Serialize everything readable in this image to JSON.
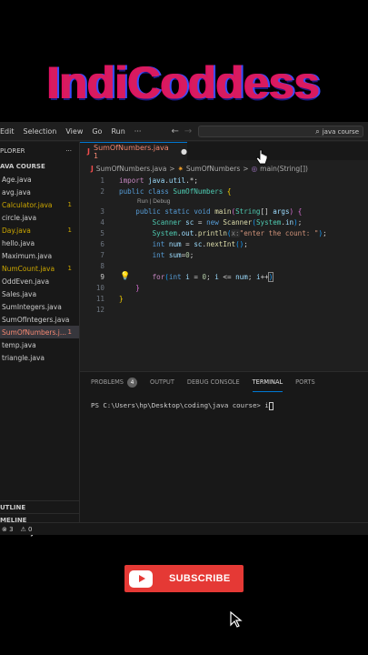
{
  "brand": {
    "title": "IndiCoddess"
  },
  "titlebar": {
    "menu": [
      "Edit",
      "Selection",
      "View",
      "Go",
      "Run",
      "···"
    ],
    "back": "←",
    "forward": "→",
    "search_text": "java course"
  },
  "sidebar": {
    "explorer_label": "PLORER",
    "more": "···",
    "folder_label": "AVA COURSE",
    "files": [
      {
        "name": "Age.java",
        "badge": "",
        "state": "normal"
      },
      {
        "name": "avg.java",
        "badge": "",
        "state": "normal"
      },
      {
        "name": "Calculator.java",
        "badge": "1",
        "state": "warn"
      },
      {
        "name": "circle.java",
        "badge": "",
        "state": "normal"
      },
      {
        "name": "Day.java",
        "badge": "1",
        "state": "warn"
      },
      {
        "name": "hello.java",
        "badge": "",
        "state": "normal"
      },
      {
        "name": "Maximum.java",
        "badge": "",
        "state": "normal"
      },
      {
        "name": "NumCount.java",
        "badge": "1",
        "state": "warn"
      },
      {
        "name": "OddEven.java",
        "badge": "",
        "state": "normal"
      },
      {
        "name": "Sales.java",
        "badge": "",
        "state": "normal"
      },
      {
        "name": "SumIntegers.java",
        "badge": "",
        "state": "normal"
      },
      {
        "name": "SumOfIntegers.java",
        "badge": "",
        "state": "normal"
      },
      {
        "name": "SumOfNumbers.j...",
        "badge": "1",
        "state": "err"
      },
      {
        "name": "temp.java",
        "badge": "",
        "state": "normal"
      },
      {
        "name": "triangle.java",
        "badge": "",
        "state": "normal"
      }
    ],
    "outline": "UTLINE",
    "timeline": "MELINE",
    "java_projects": "AVA PROJECTS"
  },
  "tab": {
    "icon": "J",
    "label": "SumOfNumbers.java 1",
    "dot": "●"
  },
  "breadcrumb": {
    "file_icon": "J",
    "file": "SumOfNumbers.java",
    "sep1": ">",
    "class_icon": "✷",
    "class": "SumOfNumbers",
    "sep2": ">",
    "method_icon": "◎",
    "method": "main(String[])"
  },
  "editor": {
    "line_numbers": [
      "1",
      "2",
      "3",
      "4",
      "5",
      "6",
      "7",
      "8",
      "9",
      "10",
      "11",
      "12"
    ],
    "codelens": "Run | Debug"
  },
  "panel": {
    "tabs": [
      "PROBLEMS",
      "OUTPUT",
      "DEBUG CONSOLE",
      "TERMINAL",
      "PORTS"
    ],
    "problems_count": "4",
    "prompt": "PS C:\\Users\\hp\\Desktop\\coding\\java course> ",
    "typed": "i"
  },
  "statusbar": {
    "errors": "⊗ 3",
    "warnings": "⚠ 0"
  },
  "subscribe": {
    "label": "SUBSCRIBE"
  },
  "colors": {
    "accent": "#0078d4",
    "subscribe_red": "#e53935",
    "error_file": "#f48771",
    "warn_file": "#cca700"
  }
}
